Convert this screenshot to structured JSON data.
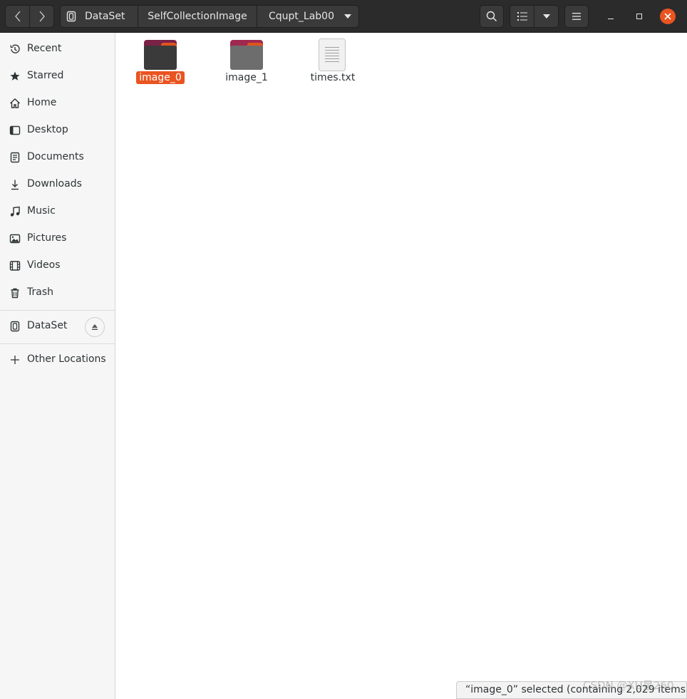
{
  "header": {
    "breadcrumbs": [
      "DataSet",
      "SelfCollectionImage",
      "Cqupt_Lab00"
    ]
  },
  "sidebar": {
    "items": [
      {
        "label": "Recent",
        "icon": "clock-icon"
      },
      {
        "label": "Starred",
        "icon": "star-icon"
      },
      {
        "label": "Home",
        "icon": "home-icon"
      },
      {
        "label": "Desktop",
        "icon": "desktop-icon"
      },
      {
        "label": "Documents",
        "icon": "document-icon"
      },
      {
        "label": "Downloads",
        "icon": "download-icon"
      },
      {
        "label": "Music",
        "icon": "music-icon"
      },
      {
        "label": "Pictures",
        "icon": "picture-icon"
      },
      {
        "label": "Videos",
        "icon": "film-icon"
      },
      {
        "label": "Trash",
        "icon": "trash-icon"
      }
    ],
    "devices": [
      {
        "label": "DataSet",
        "icon": "drive-icon"
      }
    ],
    "other_locations": "Other Locations"
  },
  "files": [
    {
      "name": "image_0",
      "type": "folder",
      "selected": true
    },
    {
      "name": "image_1",
      "type": "folder",
      "selected": false
    },
    {
      "name": "times.txt",
      "type": "text-file",
      "selected": false
    }
  ],
  "status": "“image_0” selected  (containing 2,029 items)",
  "watermark": "CSDN @XU是260",
  "colors": {
    "accent": "#e95420",
    "headerbar": "#2b2b2b",
    "sidebar": "#f6f6f6"
  }
}
